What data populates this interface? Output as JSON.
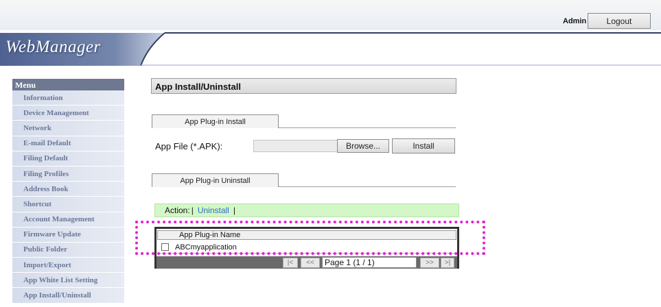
{
  "topbar": {
    "user": "Admin",
    "logout_label": "Logout"
  },
  "header": {
    "logo": "WebManager",
    "colors": {
      "band": "#5b6d95",
      "accent": "#2f3e63"
    }
  },
  "sidebar": {
    "title": "Menu",
    "items": [
      {
        "label": "Information"
      },
      {
        "label": "Device Management"
      },
      {
        "label": "Network"
      },
      {
        "label": "E-mail Default"
      },
      {
        "label": "Filing Default"
      },
      {
        "label": "Filing Profiles"
      },
      {
        "label": "Address Book"
      },
      {
        "label": "Shortcut"
      },
      {
        "label": "Account Management"
      },
      {
        "label": "Firmware Update"
      },
      {
        "label": "Public Folder"
      },
      {
        "label": "Import/Export"
      },
      {
        "label": "App White List Setting"
      },
      {
        "label": "App Install/Uninstall"
      }
    ]
  },
  "main": {
    "title": "App Install/Uninstall",
    "install_tab": "App Plug-in Install",
    "file_label": "App File (*.APK):",
    "browse_label": "Browse...",
    "install_label": "Install",
    "uninstall_tab": "App Plug-in Uninstall",
    "action_label": "Action:",
    "action_separator_1": "|",
    "action_uninstall": "Uninstall",
    "action_separator_2": "|",
    "table": {
      "column": "App Plug-in Name",
      "rows": [
        {
          "name": "ABCmyapplication",
          "checked": false
        }
      ]
    },
    "pager": {
      "first": "|<",
      "prev": "<<",
      "page": "Page 1 (1 / 1)",
      "next": ">>",
      "last": ">|"
    }
  },
  "highlight_color": "#e21fd0"
}
